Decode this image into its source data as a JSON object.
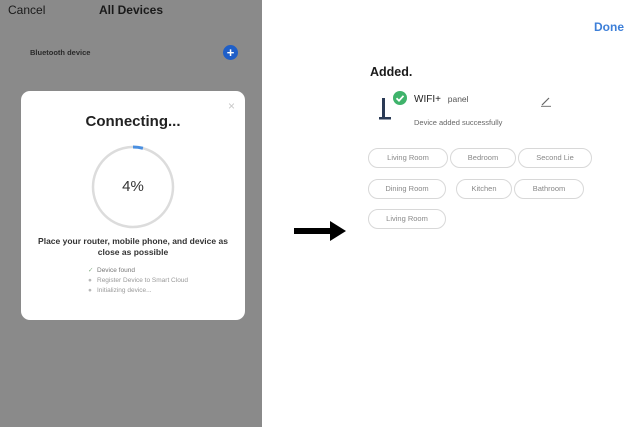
{
  "left_screen": {
    "cancel_label": "Cancel",
    "title": "All Devices",
    "bluetooth_label": "Bluetooth device",
    "add_icon": "+"
  },
  "modal": {
    "close_icon": "×",
    "title": "Connecting...",
    "progress_percent": 4,
    "progress_label": "4%",
    "instruction": "Place your router, mobile phone, and device as close as possible",
    "steps": [
      {
        "label": "Device found",
        "status": "done",
        "mark": "✓"
      },
      {
        "label": "Register Device to Smart Cloud",
        "status": "pending",
        "mark": "●"
      },
      {
        "label": "Initializing device...",
        "status": "pending",
        "mark": "●"
      }
    ]
  },
  "right_screen": {
    "done_label": "Done",
    "added_heading": "Added.",
    "device_name": "WIFI+",
    "device_model": "panel",
    "device_status": "Device added successfully",
    "rooms": [
      "Living Room",
      "Bedroom",
      "Second Lie",
      "Dining Room",
      "Kitchen",
      "Bathroom",
      "Living Room"
    ]
  },
  "colors": {
    "overlay_gray": "#8a8a8a",
    "accent_blue": "#3d7fd8",
    "success_green": "#3fb36b",
    "progress_blue": "#4a8fe0"
  }
}
